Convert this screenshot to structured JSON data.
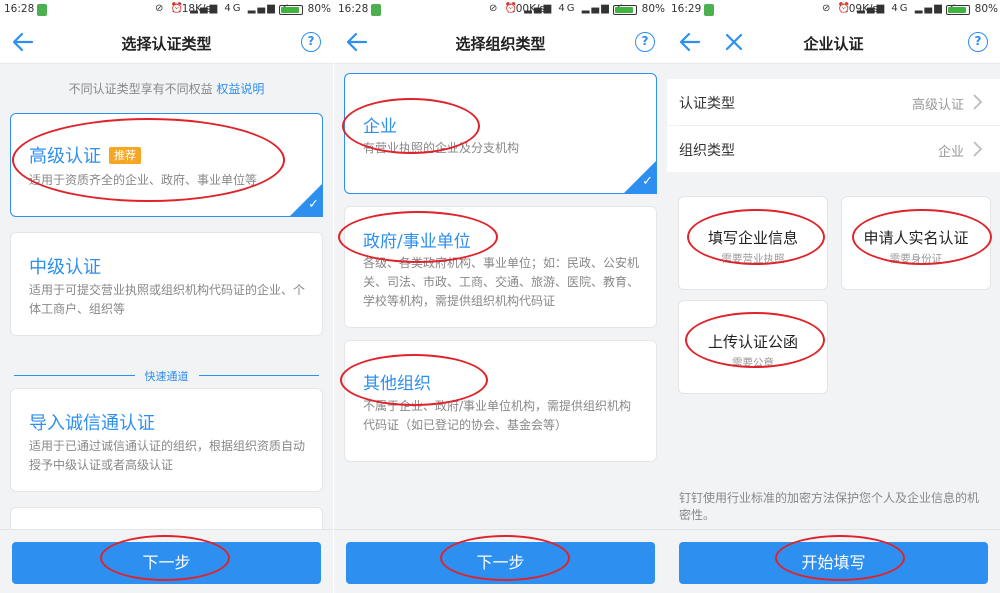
{
  "status_bars": [
    {
      "time": "16:28",
      "speed": "3.18K/s",
      "network": "4G",
      "battery_pct": "80%",
      "battery_level": 0.8
    },
    {
      "time": "16:28",
      "speed": "0.00K/s",
      "network": "4G",
      "battery_pct": "80%",
      "battery_level": 0.8
    },
    {
      "time": "16:29",
      "speed": "0.09K/s",
      "network": "4G",
      "battery_pct": "80%",
      "battery_level": 0.8
    }
  ],
  "screen1": {
    "title": "选择认证类型",
    "hint_text": "不同认证类型享有不同权益",
    "hint_link": "权益说明",
    "cards": [
      {
        "title": "高级认证",
        "badge": "推荐",
        "desc": "适用于资质齐全的企业、政府、事业单位等",
        "selected": true
      },
      {
        "title": "中级认证",
        "desc": "适用于可提交营业执照或组织机构代码证的企业、个体工商户、组织等"
      },
      {
        "title": "导入诚信通认证",
        "desc": "适用于已通过诚信通认证的组织，根据组织资质自动授予中级认证或者高级认证"
      }
    ],
    "divider_label": "快速通道",
    "next_button": "下一步"
  },
  "screen2": {
    "title": "选择组织类型",
    "cards": [
      {
        "title": "企业",
        "desc": "有营业执照的企业及分支机构",
        "selected": true
      },
      {
        "title": "政府/事业单位",
        "desc": "各级、各类政府机构、事业单位；如：民政、公安机关、司法、市政、工商、交通、旅游、医院、教育、学校等机构，需提供组织机构代码证"
      },
      {
        "title": "其他组织",
        "desc": "不属于企业、政府/事业单位机构，需提供组织机构代码证（如已登记的协会、基金会等）"
      }
    ],
    "next_button": "下一步"
  },
  "screen3": {
    "title": "企业认证",
    "rows": [
      {
        "label": "认证类型",
        "value": "高级认证"
      },
      {
        "label": "组织类型",
        "value": "企业"
      }
    ],
    "options": [
      {
        "title": "填写企业信息",
        "sub": "需要营业执照"
      },
      {
        "title": "申请人实名认证",
        "sub": "需要身份证"
      },
      {
        "title": "上传认证公函",
        "sub": "需要公章"
      }
    ],
    "security_note": "钉钉使用行业标准的加密方法保护您个人及企业信息的机密性。",
    "start_button": "开始填写"
  },
  "colors": {
    "accent": "#2d8ff0",
    "badge": "#f5a623",
    "annotation": "#e0232a"
  }
}
